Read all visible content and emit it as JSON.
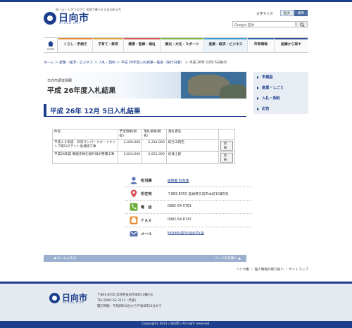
{
  "header": {
    "tagline": "海・山・人がつながり 笑顔で暮らせる日向市まち",
    "logo": "日向市",
    "logo_sub": "HYUGA CITY",
    "fontsize_label": "文字サイズ",
    "fontsize_large": "拡大",
    "fontsize_standard": "標準",
    "search_placeholder": "Google 提供"
  },
  "nav": {
    "home_label": "HOME",
    "items": [
      {
        "label": "くらし・手続き",
        "color": "#e58a2e"
      },
      {
        "label": "子育て・教育",
        "color": "#e2a23c"
      },
      {
        "label": "健康・医療・福祉",
        "color": "#d9534f"
      },
      {
        "label": "観光・文化・スポーツ",
        "color": "#7db53c"
      },
      {
        "label": "産業・経済・ビジネス",
        "color": "#3f9bd3"
      },
      {
        "label": "市政情報",
        "color": "#2f66b2"
      },
      {
        "label": "組織から探す",
        "color": "#2c4e96"
      }
    ]
  },
  "breadcrumb": {
    "items": [
      "ホーム",
      "産業・経済・ビジネス",
      "入札・契約",
      "平成 26年度入札結果一覧表（執行日順）"
    ],
    "current": "平成 26年 12月 5日執行"
  },
  "banner": {
    "subtitle": "日向市調達情報",
    "title": "平成 26年度入札結果"
  },
  "sidebar": {
    "items": [
      "市建設",
      "産業・しごと",
      "入札・契約",
      "広告"
    ]
  },
  "page_title": "平成 26年 12月 5日入札結果",
  "table": {
    "headers": [
      "件名",
      "予定価格(税抜)",
      "落札価格(税抜)",
      "落札者名",
      ""
    ],
    "rows": [
      {
        "name": "平成２６年度　日向サンパークオートキャンプ場ログテント他補修工事",
        "planned": "2,400,000",
        "winning": "2,314,000",
        "winner": "総合工務店",
        "action": "詳細"
      },
      {
        "name": "平成26年度 車脇支線仕線外排水整備工事",
        "planned": "2,623,000",
        "winning": "2,621,000",
        "winner": "松澤土建",
        "action": "詳細"
      }
    ]
  },
  "contact": {
    "dept_label": "担当課",
    "dept_value": "総務部 財政課",
    "addr_label": "所在地",
    "addr_value": "〒883-8555 宮崎県日向市本町10番5号",
    "tel_label": "電　話",
    "tel_value": "0982-54-5761",
    "fax_label": "ＦＡＸ",
    "fax_value": "0982-54-8747",
    "mail_label": "メール",
    "mail_value": "keiyaku@hyugacity.jp"
  },
  "pager": {
    "prev": "ホームに戻る",
    "top": "ページの先頭へ"
  },
  "footlinks": "リンク集 ｜ 個人情報の取り扱い ｜ サイトマップ",
  "footer": {
    "logo": "日向市",
    "logo_sub": "HYUGA CITY",
    "address": "〒883-8555 宮崎県日向市本町10番5号",
    "tel": "TEL:0982-52-2111（代表）",
    "hours": "開庁時間：午前8時30分から午後5時15分まで",
    "copyright": "Copyrights 2022 / 日向市 / All right reserved."
  }
}
